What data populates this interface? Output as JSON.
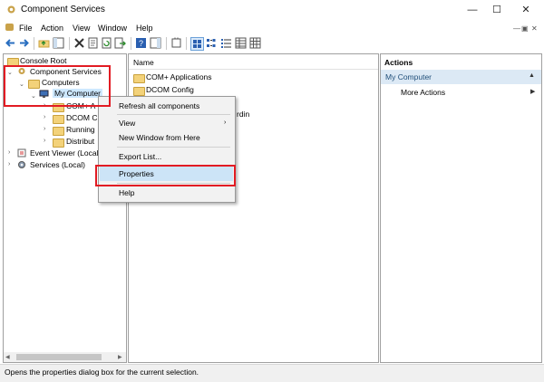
{
  "window": {
    "title": "Component Services"
  },
  "menubar": {
    "items": [
      "File",
      "Action",
      "View",
      "Window",
      "Help"
    ]
  },
  "tree": {
    "root": "Console Root",
    "component_services": "Component Services",
    "computers": "Computers",
    "my_computer": "My Computer",
    "children": [
      "COM+ A",
      "DCOM C",
      "Running",
      "Distribut"
    ],
    "event_viewer": "Event Viewer (Local",
    "services": "Services (Local)"
  },
  "list": {
    "header": "Name",
    "items": [
      "COM+ Applications",
      "DCOM Config"
    ],
    "hidden_fragment": "rdin"
  },
  "context_menu": {
    "items": [
      "Refresh all components",
      "View",
      "New Window from Here",
      "Export List...",
      "Properties",
      "Help"
    ]
  },
  "actions": {
    "header": "Actions",
    "section": "My Computer",
    "more": "More Actions"
  },
  "status": {
    "text": "Opens the properties dialog box for the current selection."
  },
  "colors": {
    "highlight": "#e21b23",
    "selection": "#cde8ff",
    "section_bg": "#dce9f5",
    "accent_text": "#1f4e79"
  }
}
